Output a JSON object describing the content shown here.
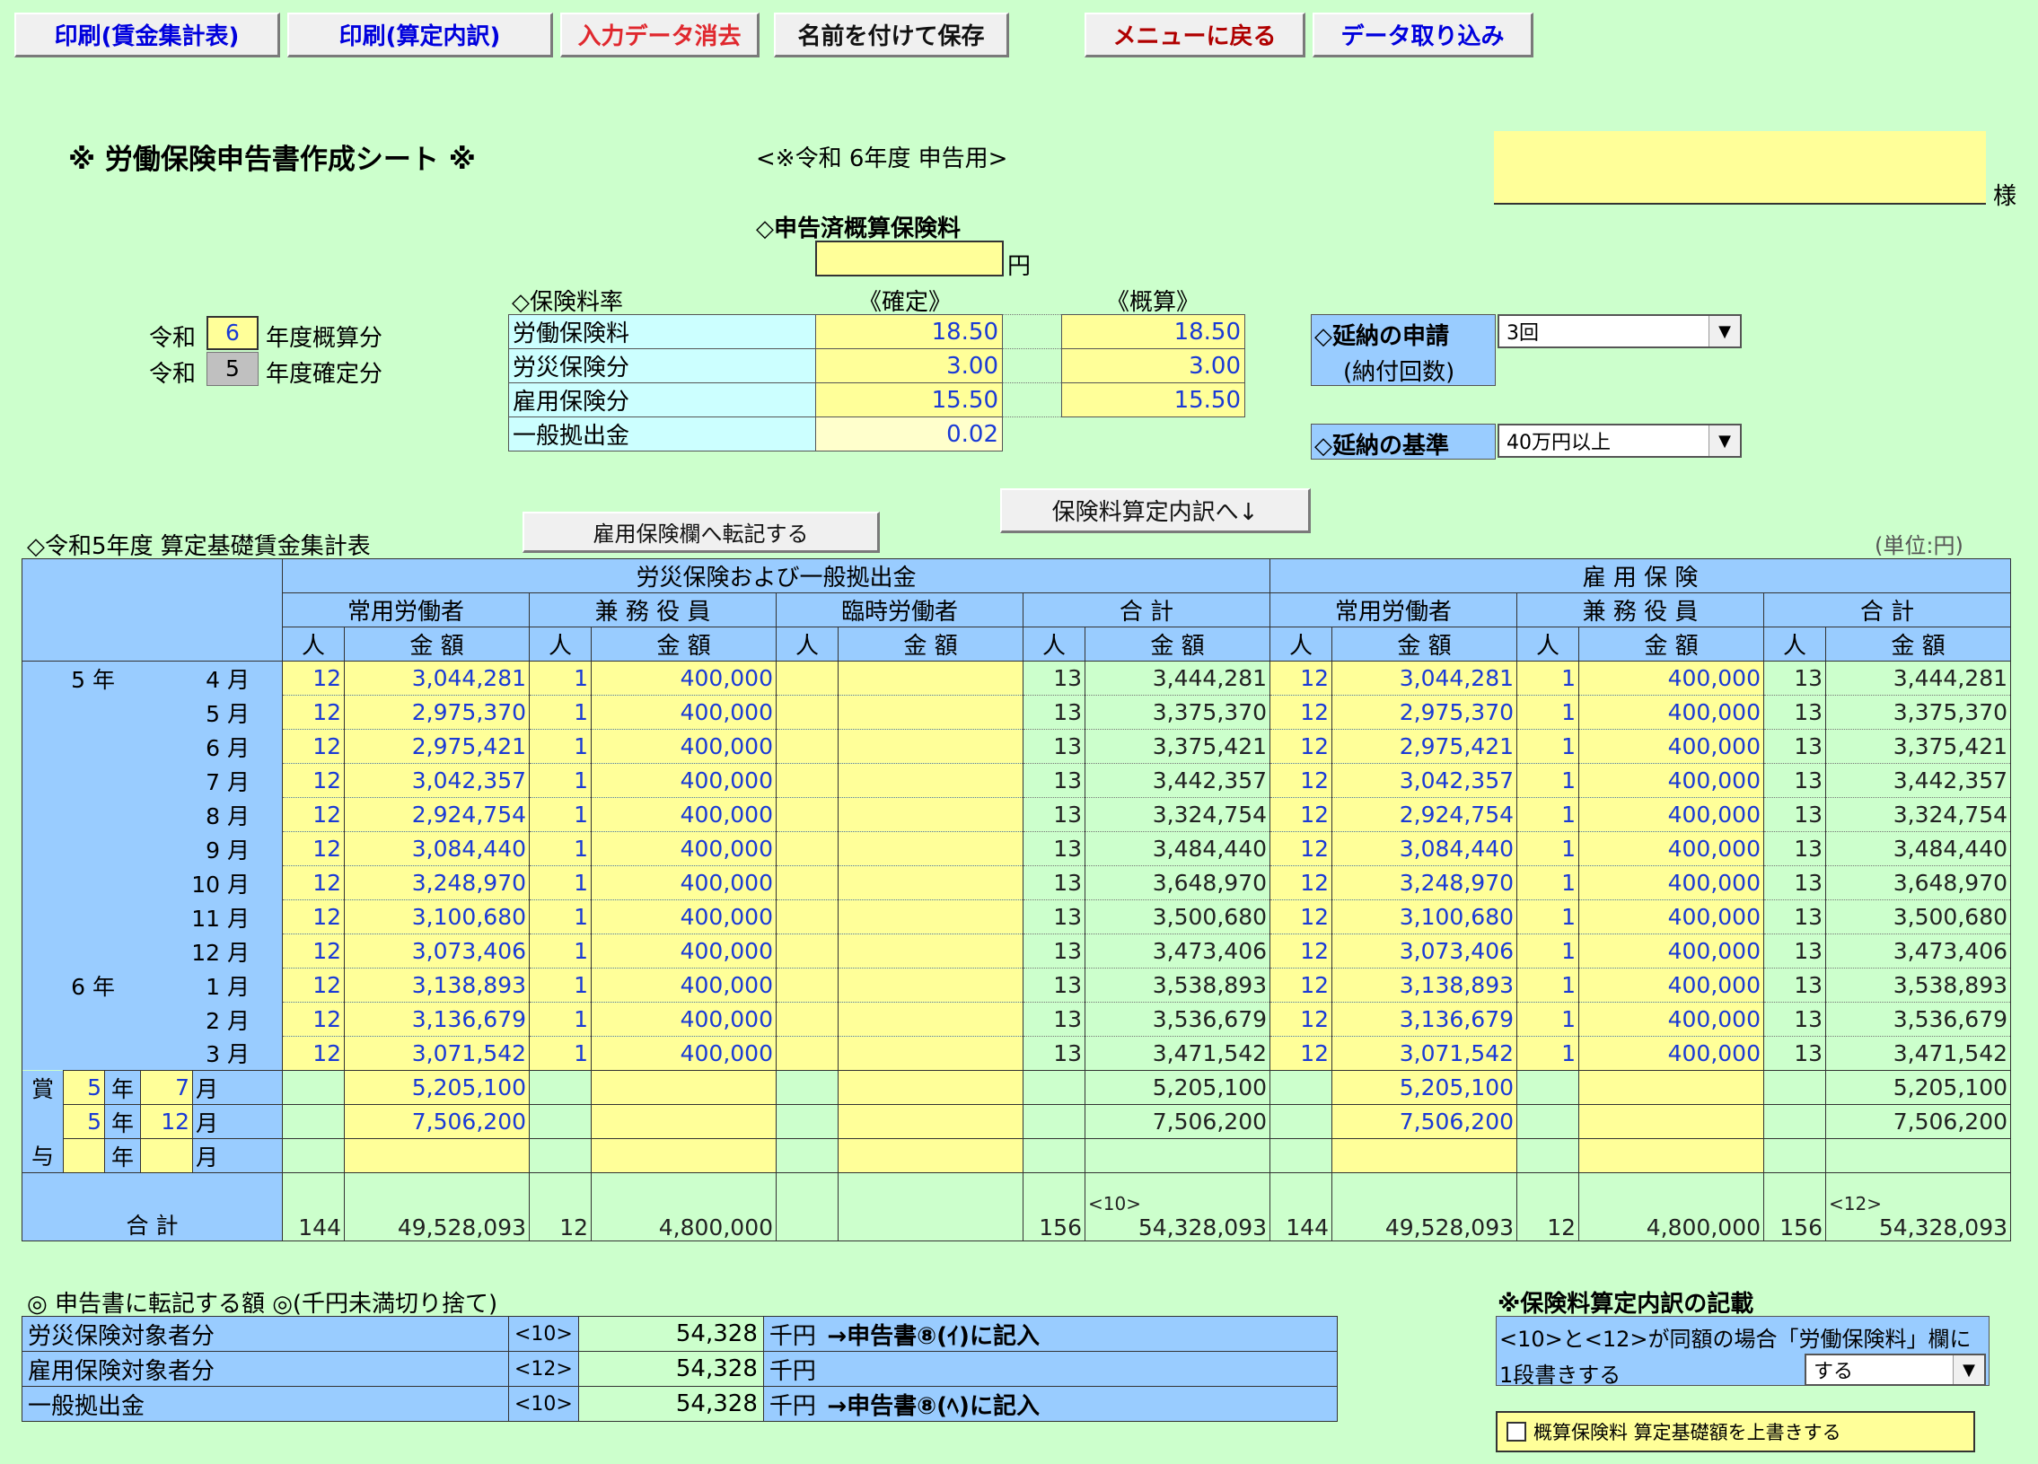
{
  "toolbar": {
    "print_wage": "印刷(賃金集計表)",
    "print_calc": "印刷(算定内訳)",
    "clear": "入力データ消去",
    "save_as": "名前を付けて保存",
    "back_menu": "メニューに戻る",
    "import": "データ取り込み"
  },
  "header": {
    "title": "※ 労働保険申告書作成シート ※",
    "year_label": "<※令和 6年度 申告用>",
    "sama": "様",
    "gaisan_label": "◇申告済概算保険料",
    "yen": "円"
  },
  "year": {
    "reiwa": "令和",
    "gaisan_year": "6",
    "gaisan_suffix": "年度概算分",
    "kakutei_year": "5",
    "kakutei_suffix": "年度確定分"
  },
  "rates": {
    "header": "◇保険料率",
    "kakutei": "《確定》",
    "gaisan": "《概算》",
    "rows": [
      {
        "label": "労働保険料",
        "kakutei": "18.50",
        "gaisan": "18.50"
      },
      {
        "label": "労災保険分",
        "kakutei": "3.00",
        "gaisan": "3.00"
      },
      {
        "label": "雇用保険分",
        "kakutei": "15.50",
        "gaisan": "15.50"
      },
      {
        "label": "一般拠出金",
        "kakutei": "0.02",
        "gaisan": ""
      }
    ]
  },
  "ennou": {
    "label1": "◇延納の申請",
    "label1b": "(納付回数)",
    "value1": "3回",
    "label2": "◇延納の基準",
    "value2": "40万円以上"
  },
  "buttons2": {
    "koyou": "雇用保険欄へ転記する",
    "uchiwake": "保険料算定内訳へ↓"
  },
  "table": {
    "title": "◇令和5年度 算定基礎賃金集計表",
    "unit": "(単位:円)",
    "group1": "労災保険および一般拠出金",
    "group2": "雇 用 保 険",
    "sub": [
      "常用労働者",
      "兼 務 役 員",
      "臨時労働者",
      "合  計",
      "常用労働者",
      "兼 務 役 員",
      "合  計"
    ],
    "nin": "人",
    "kingaku": "金  額",
    "rows": [
      {
        "y": "5 年",
        "m": "4 月",
        "c1": "12",
        "a1": "3,044,281",
        "c2": "1",
        "a2": "400,000",
        "tc": "13",
        "ta": "3,444,281",
        "e1": "12",
        "ea1": "3,044,281",
        "e2": "1",
        "ea2": "400,000",
        "etc": "13",
        "eta": "3,444,281"
      },
      {
        "y": "",
        "m": "5 月",
        "c1": "12",
        "a1": "2,975,370",
        "c2": "1",
        "a2": "400,000",
        "tc": "13",
        "ta": "3,375,370",
        "e1": "12",
        "ea1": "2,975,370",
        "e2": "1",
        "ea2": "400,000",
        "etc": "13",
        "eta": "3,375,370"
      },
      {
        "y": "",
        "m": "6 月",
        "c1": "12",
        "a1": "2,975,421",
        "c2": "1",
        "a2": "400,000",
        "tc": "13",
        "ta": "3,375,421",
        "e1": "12",
        "ea1": "2,975,421",
        "e2": "1",
        "ea2": "400,000",
        "etc": "13",
        "eta": "3,375,421"
      },
      {
        "y": "",
        "m": "7 月",
        "c1": "12",
        "a1": "3,042,357",
        "c2": "1",
        "a2": "400,000",
        "tc": "13",
        "ta": "3,442,357",
        "e1": "12",
        "ea1": "3,042,357",
        "e2": "1",
        "ea2": "400,000",
        "etc": "13",
        "eta": "3,442,357"
      },
      {
        "y": "",
        "m": "8 月",
        "c1": "12",
        "a1": "2,924,754",
        "c2": "1",
        "a2": "400,000",
        "tc": "13",
        "ta": "3,324,754",
        "e1": "12",
        "ea1": "2,924,754",
        "e2": "1",
        "ea2": "400,000",
        "etc": "13",
        "eta": "3,324,754"
      },
      {
        "y": "",
        "m": "9 月",
        "c1": "12",
        "a1": "3,084,440",
        "c2": "1",
        "a2": "400,000",
        "tc": "13",
        "ta": "3,484,440",
        "e1": "12",
        "ea1": "3,084,440",
        "e2": "1",
        "ea2": "400,000",
        "etc": "13",
        "eta": "3,484,440"
      },
      {
        "y": "",
        "m": "10 月",
        "c1": "12",
        "a1": "3,248,970",
        "c2": "1",
        "a2": "400,000",
        "tc": "13",
        "ta": "3,648,970",
        "e1": "12",
        "ea1": "3,248,970",
        "e2": "1",
        "ea2": "400,000",
        "etc": "13",
        "eta": "3,648,970"
      },
      {
        "y": "",
        "m": "11 月",
        "c1": "12",
        "a1": "3,100,680",
        "c2": "1",
        "a2": "400,000",
        "tc": "13",
        "ta": "3,500,680",
        "e1": "12",
        "ea1": "3,100,680",
        "e2": "1",
        "ea2": "400,000",
        "etc": "13",
        "eta": "3,500,680"
      },
      {
        "y": "",
        "m": "12 月",
        "c1": "12",
        "a1": "3,073,406",
        "c2": "1",
        "a2": "400,000",
        "tc": "13",
        "ta": "3,473,406",
        "e1": "12",
        "ea1": "3,073,406",
        "e2": "1",
        "ea2": "400,000",
        "etc": "13",
        "eta": "3,473,406"
      },
      {
        "y": "6 年",
        "m": "1 月",
        "c1": "12",
        "a1": "3,138,893",
        "c2": "1",
        "a2": "400,000",
        "tc": "13",
        "ta": "3,538,893",
        "e1": "12",
        "ea1": "3,138,893",
        "e2": "1",
        "ea2": "400,000",
        "etc": "13",
        "eta": "3,538,893"
      },
      {
        "y": "",
        "m": "2 月",
        "c1": "12",
        "a1": "3,136,679",
        "c2": "1",
        "a2": "400,000",
        "tc": "13",
        "ta": "3,536,679",
        "e1": "12",
        "ea1": "3,136,679",
        "e2": "1",
        "ea2": "400,000",
        "etc": "13",
        "eta": "3,536,679"
      },
      {
        "y": "",
        "m": "3 月",
        "c1": "12",
        "a1": "3,071,542",
        "c2": "1",
        "a2": "400,000",
        "tc": "13",
        "ta": "3,471,542",
        "e1": "12",
        "ea1": "3,071,542",
        "e2": "1",
        "ea2": "400,000",
        "etc": "13",
        "eta": "3,471,542"
      }
    ],
    "bonus_chars": [
      "賞",
      "",
      "与"
    ],
    "bonus": [
      {
        "y": "5",
        "m": "7",
        "a1": "5,205,100",
        "ta": "5,205,100",
        "ea1": "5,205,100",
        "eta": "5,205,100"
      },
      {
        "y": "5",
        "m": "12",
        "a1": "7,506,200",
        "ta": "7,506,200",
        "ea1": "7,506,200",
        "eta": "7,506,200"
      },
      {
        "y": "",
        "m": "",
        "a1": "",
        "ta": "",
        "ea1": "",
        "eta": ""
      }
    ],
    "nen": "年",
    "gatsu": "月",
    "total": {
      "label": "合 計",
      "c1": "144",
      "a1": "49,528,093",
      "c2": "12",
      "a2": "4,800,000",
      "tc": "156",
      "ta": "54,328,093",
      "e1": "144",
      "ea1": "49,528,093",
      "e2": "12",
      "ea2": "4,800,000",
      "etc": "156",
      "eta": "54,328,093",
      "ref1": "<10>",
      "ref2": "<12>"
    }
  },
  "summary": {
    "title": "◎ 申告書に転記する額 ◎(千円未満切り捨て)",
    "rows": [
      {
        "label": "労災保険対象者分",
        "ref": "<10>",
        "value": "54,328",
        "unit": "千円",
        "note": "→申告書⑧(ｲ)に記入"
      },
      {
        "label": "雇用保険対象者分",
        "ref": "<12>",
        "value": "54,328",
        "unit": "千円",
        "note": ""
      },
      {
        "label": "一般拠出金",
        "ref": "<10>",
        "value": "54,328",
        "unit": "千円",
        "note": "→申告書⑧(ﾍ)に記入"
      }
    ]
  },
  "note": {
    "title": "※保険料算定内訳の記載",
    "line1": "<10>と<12>が同額の場合「労働保険料」欄に",
    "line2": "1段書きする",
    "select": "する",
    "checkbox": "概算保険料 算定基礎額を上書きする"
  }
}
